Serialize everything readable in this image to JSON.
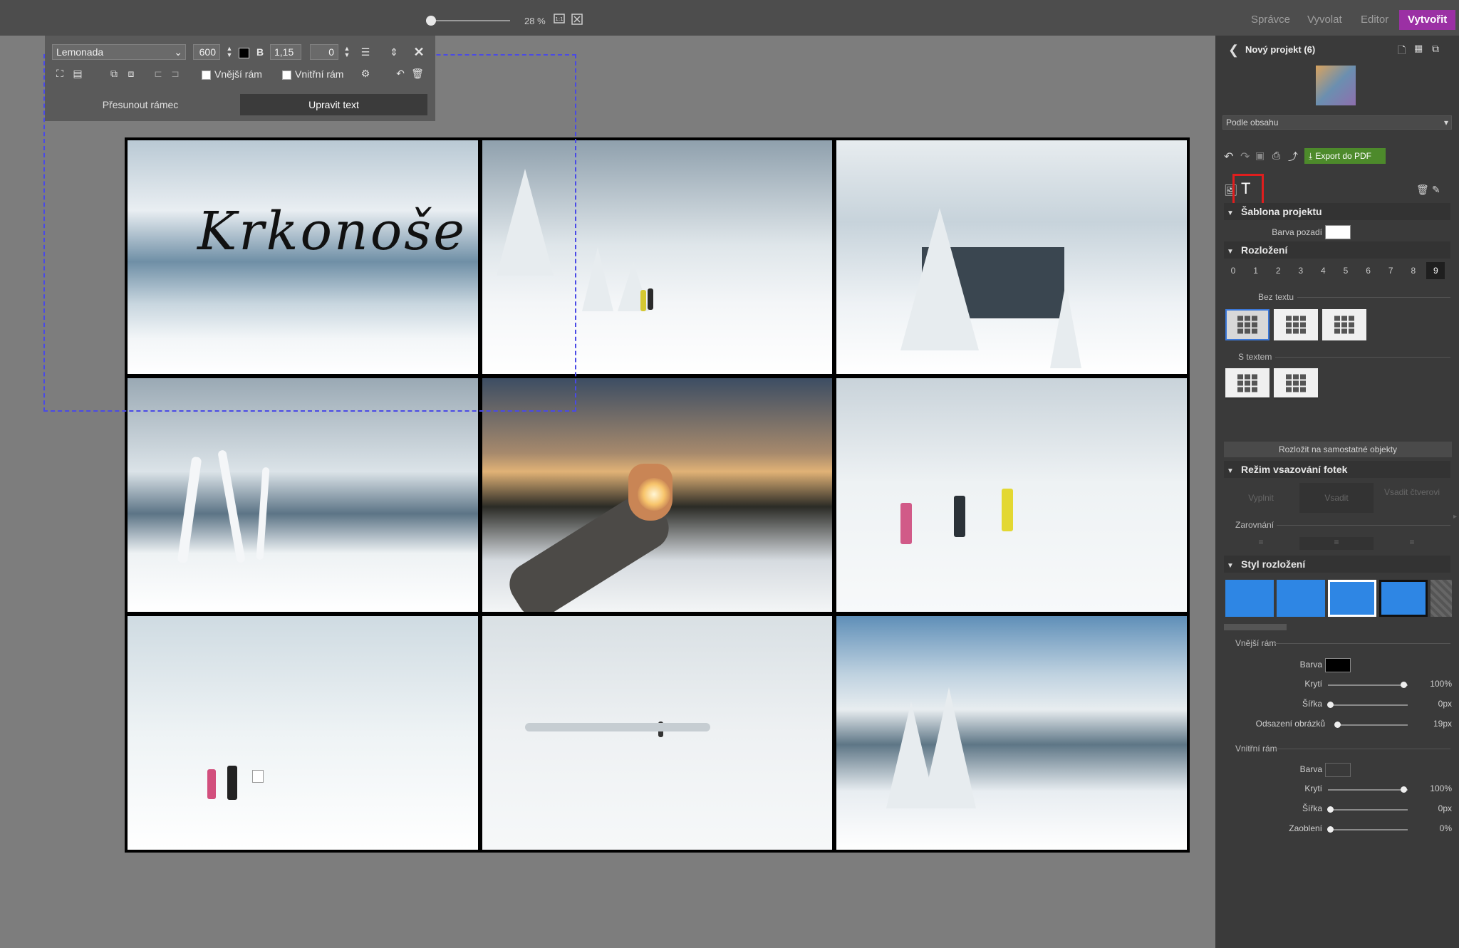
{
  "topbar": {
    "zoom_percent": "28 %",
    "zoom_slider_fraction": 0.06,
    "modes": [
      {
        "label": "Správce",
        "active": false
      },
      {
        "label": "Vyvolat",
        "active": false
      },
      {
        "label": "Editor",
        "active": false
      },
      {
        "label": "Vytvořit",
        "active": true
      }
    ],
    "accent_color": "#9b30a4"
  },
  "text_toolbar": {
    "font": "Lemonada",
    "font_size": "600",
    "line_spacing": "1,15",
    "letter_spacing": "0",
    "bold_label": "B",
    "outer_frame_label": "Vnější rám",
    "inner_frame_label": "Vnitřní rám",
    "move_frame_label": "Přesunout rámec",
    "edit_text_label": "Upravit text"
  },
  "canvas": {
    "title_text": "Krkonoše",
    "photos": [
      "snowy clouds over ridge",
      "hikers on snowy trail",
      "snow-covered trees by lodge",
      "frozen plants",
      "hand framing sun",
      "three hikers in fog",
      "couple at signpost",
      "lone hiker in snowfield",
      "frosted spruces under blue sky"
    ]
  },
  "panel": {
    "project_title": "Nový projekt (6)",
    "sort_dropdown": "Podle obsahu",
    "export_label": "Export do PDF",
    "template_section": "Šablona projektu",
    "bg_color_label": "Barva pozadí",
    "layout_section": "Rozložení",
    "layout_counts": [
      "0",
      "1",
      "2",
      "3",
      "4",
      "5",
      "6",
      "7",
      "8",
      "9"
    ],
    "layout_count_active": "9",
    "no_text_label": "Bez textu",
    "with_text_label": "S textem",
    "split_button": "Rozložit na samostatné objekty",
    "fit_section": "Režim vsazování fotek",
    "fit_options": [
      "Vyplnit",
      "Vsadit",
      "Vsadit čtverovi"
    ],
    "align_label": "Zarovnání",
    "style_section": "Styl rozložení",
    "outer_frame": {
      "label": "Vnější rám",
      "color_label": "Barva",
      "color": "#000000",
      "opacity_label": "Krytí",
      "opacity_value": "100%",
      "width_label": "Šířka",
      "width_value": "0px",
      "spacing_label": "Odsazení obrázků",
      "spacing_value": "19px"
    },
    "inner_frame": {
      "label": "Vnitřní rám",
      "color_label": "Barva",
      "opacity_label": "Krytí",
      "opacity_value": "100%",
      "width_label": "Šířka",
      "width_value": "0px",
      "rounding_label": "Zaoblení",
      "rounding_value": "0%"
    }
  }
}
